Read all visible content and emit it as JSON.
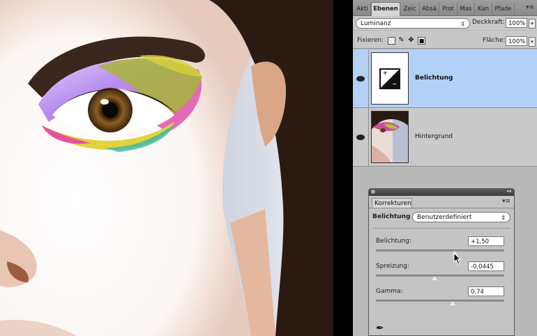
{
  "layers_panel": {
    "tabs": [
      "Akti",
      "Ebenen",
      "Zeic",
      "Absä",
      "Prot",
      "Mas",
      "Kan",
      "Pfade"
    ],
    "active_tab": "Ebenen",
    "blend_mode": "Luminanz",
    "opacity_label": "Deckkraft:",
    "opacity_value": "100%",
    "lock_label": "Fixieren:",
    "fill_label": "Fläche:",
    "fill_value": "100%",
    "layers": [
      {
        "name": "Belichtung",
        "selected": true,
        "visible": true,
        "kind": "adjustment"
      },
      {
        "name": "Hintergrund",
        "selected": false,
        "visible": true,
        "kind": "image"
      }
    ]
  },
  "adjustments_panel": {
    "tab": "Korrekturen",
    "adjustment_label": "Belichtung",
    "preset": "Benutzerdefiniert",
    "controls": [
      {
        "label": "Belichtung:",
        "value": "+1,50",
        "position": 0.7
      },
      {
        "label": "Spreizung:",
        "value": "-0,0445",
        "position": 0.5
      },
      {
        "label": "Gamma:",
        "value": "0,74",
        "position": 0.6
      }
    ]
  },
  "colors": {
    "selected_layer": "#b3d0f7",
    "panel_bg": "#b9b9b9"
  }
}
